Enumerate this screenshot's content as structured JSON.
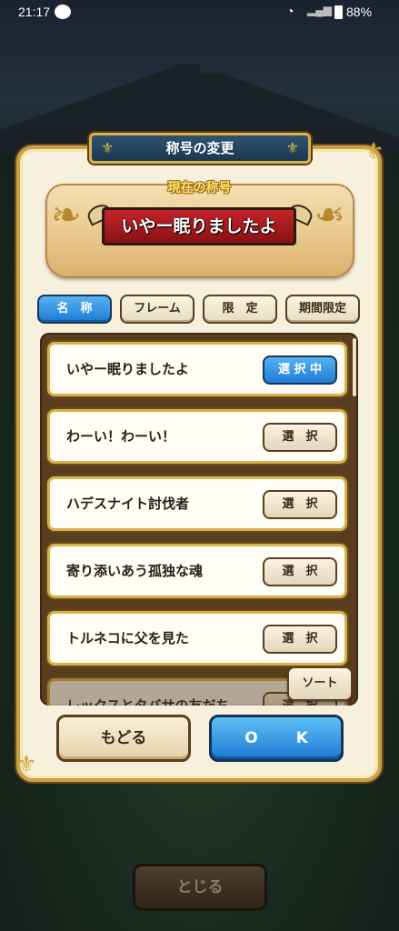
{
  "status_bar": {
    "time": "21:17",
    "battery": "88%"
  },
  "dialog": {
    "title": "称号の変更",
    "current_label": "現在の称号",
    "current_title": "いやー眠りましたよ"
  },
  "tabs": [
    {
      "label": "名　称",
      "active": true
    },
    {
      "label": "フレーム",
      "active": false
    },
    {
      "label": "限　定",
      "active": false
    },
    {
      "label": "期間限定",
      "active": false
    }
  ],
  "titles": [
    {
      "label": "いやー眠りましたよ",
      "button": "選 択 中",
      "selected": true
    },
    {
      "label": "わーい！わーい！",
      "button": "選　択",
      "selected": false
    },
    {
      "label": "ハデスナイト討伐者",
      "button": "選　択",
      "selected": false
    },
    {
      "label": "寄り添いあう孤独な魂",
      "button": "選　択",
      "selected": false
    },
    {
      "label": "トルネコに父を見た",
      "button": "選　択",
      "selected": false
    },
    {
      "label": "レックスとタバサの友だち",
      "button": "選　択",
      "selected": false
    }
  ],
  "buttons": {
    "sort": "ソート",
    "back": "もどる",
    "ok": "O K",
    "close": "とじる"
  },
  "colors": {
    "accent_blue": "#1d7ad4",
    "frame_gold": "#d8b24a",
    "plate_red": "#c4242a",
    "panel_bg": "#f6f0dc"
  }
}
